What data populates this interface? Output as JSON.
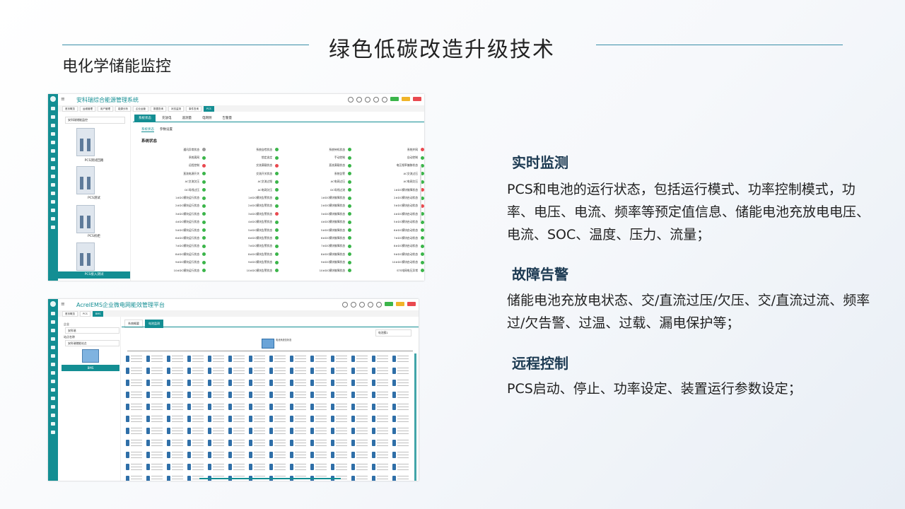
{
  "slide": {
    "title": "绿色低碳改造升级技术",
    "subtitle": "电化学储能监控"
  },
  "colors": {
    "teal": "#138e93",
    "green": "#3bb54a",
    "red": "#e9494f",
    "gray": "#9a9a9a"
  },
  "screenshot1": {
    "app_title": "安科瑞综合能源管理系统",
    "nav_tabs": [
      "首页概览",
      "运维管理",
      "用户管理",
      "能源分析",
      "企业运营",
      "数据查询",
      "状态监测",
      "事件查询",
      "PCS"
    ],
    "device_selector": "安科瑞储能监控",
    "devices": [
      "PCS测试回路",
      "PCS测试",
      "PCS机柜",
      "PCS接入测试"
    ],
    "tabs": [
      "系统状态",
      "充放电",
      "遥测量",
      "电网侧",
      "告警量"
    ],
    "subtabs": [
      "系统状态",
      "参数设置"
    ],
    "section_title": "系统状态",
    "status_items": [
      {
        "label": "通讯异常状态",
        "status": "gray"
      },
      {
        "label": "系统自检状态",
        "status": "green"
      },
      {
        "label": "系统待机状态",
        "status": "green"
      },
      {
        "label": "系统并网",
        "status": "red"
      },
      {
        "label": "系统离网",
        "status": "green"
      },
      {
        "label": "锁定选定",
        "status": "green"
      },
      {
        "label": "手动控制",
        "status": "green"
      },
      {
        "label": "自动控制",
        "status": "green"
      },
      {
        "label": "远程控制",
        "status": "red"
      },
      {
        "label": "交流满载状态",
        "status": "red"
      },
      {
        "label": "直流满载状态",
        "status": "green"
      },
      {
        "label": "电压频率偏移状态",
        "status": "green"
      },
      {
        "label": "直流电源开关",
        "status": "green"
      },
      {
        "label": "交流开关状态",
        "status": "green"
      },
      {
        "label": "系统告警",
        "status": "green"
      },
      {
        "label": "AC交流过压",
        "status": "green"
      },
      {
        "label": "AC交流欠压",
        "status": "green"
      },
      {
        "label": "AC交流过频",
        "status": "green"
      },
      {
        "label": "AC电网过压",
        "status": "green"
      },
      {
        "label": "AC电网欠压",
        "status": "green"
      },
      {
        "label": "DC母线过压",
        "status": "green"
      },
      {
        "label": "AC电网欠压",
        "status": "green"
      },
      {
        "label": "DC母线过流",
        "status": "green"
      },
      {
        "label": "1#DC模块故障状态",
        "status": "red"
      },
      {
        "label": "1#DC模块运行状态",
        "status": "green"
      },
      {
        "label": "1#DC模块告警状态",
        "status": "green"
      },
      {
        "label": "1#DC模块故障状态",
        "status": "green"
      },
      {
        "label": "2#DC模块启动状态",
        "status": "green"
      },
      {
        "label": "2#DC模块运行状态",
        "status": "green"
      },
      {
        "label": "2#DC模块告警状态",
        "status": "green"
      },
      {
        "label": "2#DC模块故障状态",
        "status": "green"
      },
      {
        "label": "3#DC模块启动状态",
        "status": "red"
      },
      {
        "label": "3#DC模块运行状态",
        "status": "green"
      },
      {
        "label": "3#DC模块告警状态",
        "status": "red"
      },
      {
        "label": "3#DC模块故障状态",
        "status": "green"
      },
      {
        "label": "4#DC模块启动状态",
        "status": "green"
      },
      {
        "label": "4#DC模块运行状态",
        "status": "green"
      },
      {
        "label": "4#DC模块告警状态",
        "status": "green"
      },
      {
        "label": "4#DC模块故障状态",
        "status": "green"
      },
      {
        "label": "5#DC模块启动状态",
        "status": "green"
      },
      {
        "label": "5#DC模块运行状态",
        "status": "green"
      },
      {
        "label": "5#DC模块告警状态",
        "status": "green"
      },
      {
        "label": "5#DC模块故障状态",
        "status": "green"
      },
      {
        "label": "6#DC模块启动状态",
        "status": "green"
      },
      {
        "label": "6#DC模块运行状态",
        "status": "green"
      },
      {
        "label": "6#DC模块告警状态",
        "status": "green"
      },
      {
        "label": "6#DC模块故障状态",
        "status": "green"
      },
      {
        "label": "7#DC模块启动状态",
        "status": "green"
      },
      {
        "label": "7#DC模块运行状态",
        "status": "green"
      },
      {
        "label": "7#DC模块告警状态",
        "status": "green"
      },
      {
        "label": "7#DC模块故障状态",
        "status": "green"
      },
      {
        "label": "8#DC模块启动状态",
        "status": "green"
      },
      {
        "label": "8#DC模块运行状态",
        "status": "green"
      },
      {
        "label": "8#DC模块告警状态",
        "status": "green"
      },
      {
        "label": "8#DC模块故障状态",
        "status": "green"
      },
      {
        "label": "9#DC模块启动状态",
        "status": "green"
      },
      {
        "label": "9#DC模块运行状态",
        "status": "green"
      },
      {
        "label": "9#DC模块告警状态",
        "status": "green"
      },
      {
        "label": "9#DC模块故障状态",
        "status": "green"
      },
      {
        "label": "10#DC模块启动状态",
        "status": "green"
      },
      {
        "label": "10#DC模块运行状态",
        "status": "green"
      },
      {
        "label": "10#DC模块告警状态",
        "status": "green"
      },
      {
        "label": "10#DC模块故障状态",
        "status": "green"
      },
      {
        "label": "STS电网电压异常",
        "status": "green"
      }
    ]
  },
  "screenshot2": {
    "app_title": "AcrelEMS企业微电网能效管理平台",
    "nav_tabs": [
      "首页概览",
      "PCS",
      "BMS"
    ],
    "enterprise_label": "企业",
    "enterprise_value": "安科瑞",
    "station_label": "站点名称",
    "station_value": "安科瑞储能站点",
    "device_label": "BMS",
    "tabs": [
      "系统概要",
      "电池监测"
    ],
    "dropdown": "电池簇1",
    "pcs_label": "电池系统总状态"
  },
  "sections": [
    {
      "heading": "实时监测",
      "body": "PCS和电池的运行状态，包括运行模式、功率控制模式，功率、电压、电流、频率等预定值信息、储能电池充放电电压、电流、SOC、温度、压力、流量；"
    },
    {
      "heading": "故障告警",
      "body": "储能电池充放电状态、交/直流过压/欠压、交/直流过流、频率过/欠告警、过温、过载、漏电保护等；"
    },
    {
      "heading": "远程控制",
      "body": "PCS启动、停止、功率设定、装置运行参数设定；"
    }
  ]
}
